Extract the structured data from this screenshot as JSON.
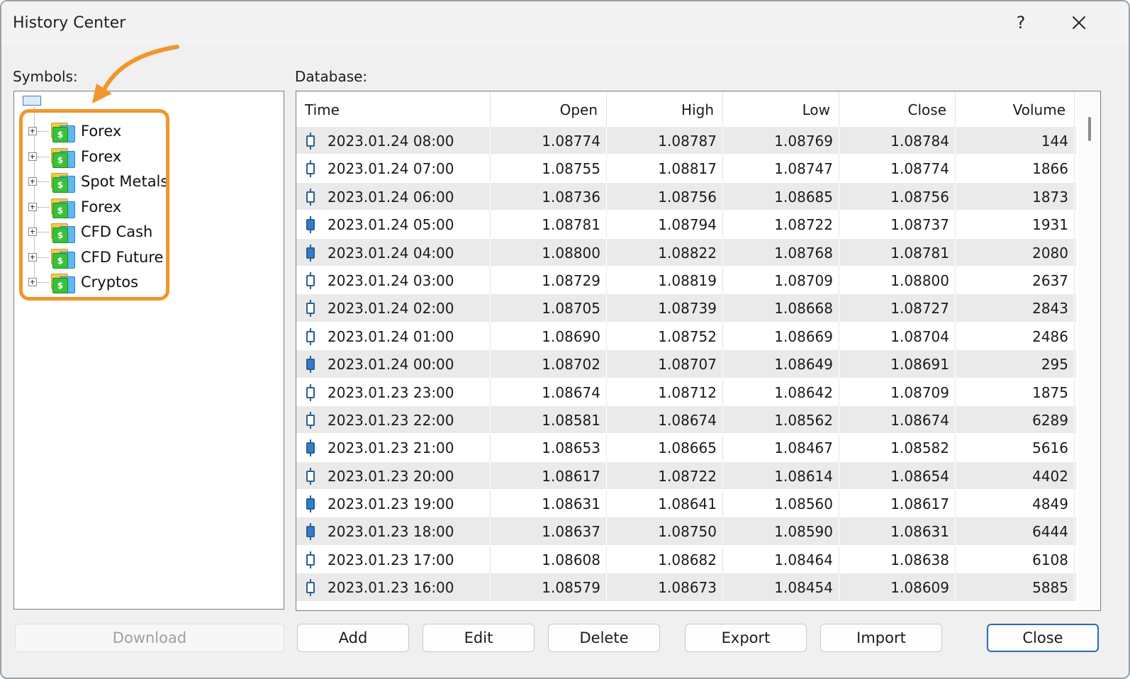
{
  "window": {
    "title": "History Center",
    "help_label": "?"
  },
  "symbols": {
    "label": "Symbols:",
    "groups": [
      "Forex",
      "Forex",
      "Spot Metals",
      "Forex",
      "CFD Cash",
      "CFD Future",
      "Cryptos"
    ]
  },
  "database": {
    "label": "Database:",
    "columns": [
      "Time",
      "Open",
      "High",
      "Low",
      "Close",
      "Volume"
    ],
    "rows": [
      {
        "time": "2023.01.24 08:00",
        "open": "1.08774",
        "high": "1.08787",
        "low": "1.08769",
        "close": "1.08784",
        "volume": "144",
        "candle": "bull"
      },
      {
        "time": "2023.01.24 07:00",
        "open": "1.08755",
        "high": "1.08817",
        "low": "1.08747",
        "close": "1.08774",
        "volume": "1866",
        "candle": "bull"
      },
      {
        "time": "2023.01.24 06:00",
        "open": "1.08736",
        "high": "1.08756",
        "low": "1.08685",
        "close": "1.08756",
        "volume": "1873",
        "candle": "bull"
      },
      {
        "time": "2023.01.24 05:00",
        "open": "1.08781",
        "high": "1.08794",
        "low": "1.08722",
        "close": "1.08737",
        "volume": "1931",
        "candle": "bear"
      },
      {
        "time": "2023.01.24 04:00",
        "open": "1.08800",
        "high": "1.08822",
        "low": "1.08768",
        "close": "1.08781",
        "volume": "2080",
        "candle": "bear"
      },
      {
        "time": "2023.01.24 03:00",
        "open": "1.08729",
        "high": "1.08819",
        "low": "1.08709",
        "close": "1.08800",
        "volume": "2637",
        "candle": "bull"
      },
      {
        "time": "2023.01.24 02:00",
        "open": "1.08705",
        "high": "1.08739",
        "low": "1.08668",
        "close": "1.08727",
        "volume": "2843",
        "candle": "bull"
      },
      {
        "time": "2023.01.24 01:00",
        "open": "1.08690",
        "high": "1.08752",
        "low": "1.08669",
        "close": "1.08704",
        "volume": "2486",
        "candle": "bull"
      },
      {
        "time": "2023.01.24 00:00",
        "open": "1.08702",
        "high": "1.08707",
        "low": "1.08649",
        "close": "1.08691",
        "volume": "295",
        "candle": "bear"
      },
      {
        "time": "2023.01.23 23:00",
        "open": "1.08674",
        "high": "1.08712",
        "low": "1.08642",
        "close": "1.08709",
        "volume": "1875",
        "candle": "bull"
      },
      {
        "time": "2023.01.23 22:00",
        "open": "1.08581",
        "high": "1.08674",
        "low": "1.08562",
        "close": "1.08674",
        "volume": "6289",
        "candle": "bull"
      },
      {
        "time": "2023.01.23 21:00",
        "open": "1.08653",
        "high": "1.08665",
        "low": "1.08467",
        "close": "1.08582",
        "volume": "5616",
        "candle": "bear"
      },
      {
        "time": "2023.01.23 20:00",
        "open": "1.08617",
        "high": "1.08722",
        "low": "1.08614",
        "close": "1.08654",
        "volume": "4402",
        "candle": "bull"
      },
      {
        "time": "2023.01.23 19:00",
        "open": "1.08631",
        "high": "1.08641",
        "low": "1.08560",
        "close": "1.08617",
        "volume": "4849",
        "candle": "bear"
      },
      {
        "time": "2023.01.23 18:00",
        "open": "1.08637",
        "high": "1.08750",
        "low": "1.08590",
        "close": "1.08631",
        "volume": "6444",
        "candle": "bear"
      },
      {
        "time": "2023.01.23 17:00",
        "open": "1.08608",
        "high": "1.08682",
        "low": "1.08464",
        "close": "1.08638",
        "volume": "6108",
        "candle": "bull"
      },
      {
        "time": "2023.01.23 16:00",
        "open": "1.08579",
        "high": "1.08673",
        "low": "1.08454",
        "close": "1.08609",
        "volume": "5885",
        "candle": "bull"
      }
    ]
  },
  "buttons": {
    "download": "Download",
    "add": "Add",
    "edit": "Edit",
    "delete": "Delete",
    "export": "Export",
    "import": "Import",
    "close": "Close"
  },
  "colors": {
    "highlight": "#f0962b",
    "bull_candle": "#ffffff",
    "bear_candle": "#2f7fd0"
  }
}
